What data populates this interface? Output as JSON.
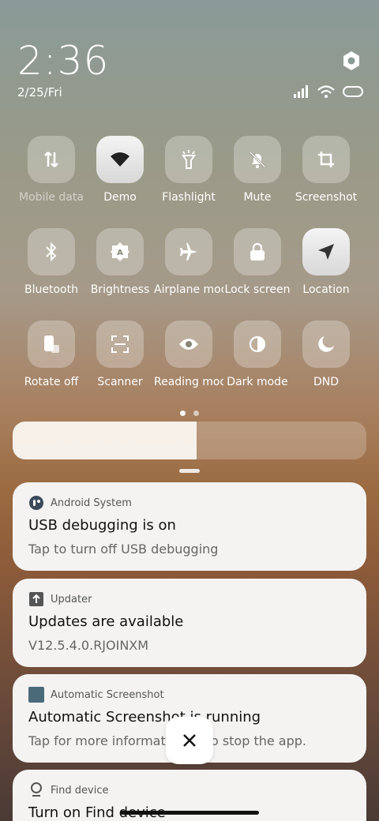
{
  "header": {
    "time": "2:36",
    "date": "2/25/Fri"
  },
  "tiles_row1": [
    {
      "label": "Mobile data",
      "icon": "mobile-data-icon"
    },
    {
      "label": "Demo",
      "icon": "wifi-icon"
    },
    {
      "label": "Flashlight",
      "icon": "flashlight-icon"
    },
    {
      "label": "Mute",
      "icon": "bell-off-icon"
    },
    {
      "label": "Screenshot",
      "icon": "screenshot-icon"
    }
  ],
  "tiles_row2": [
    {
      "label": "Bluetooth",
      "icon": "bluetooth-icon"
    },
    {
      "label": "Brightness",
      "icon": "auto-brightness-icon"
    },
    {
      "label": "Airplane mode",
      "icon": "airplane-icon"
    },
    {
      "label": "Lock screen",
      "icon": "lock-icon"
    },
    {
      "label": "Location",
      "icon": "location-icon"
    }
  ],
  "tiles_row3": [
    {
      "label": "Rotate off",
      "icon": "rotate-icon"
    },
    {
      "label": "Scanner",
      "icon": "scanner-icon"
    },
    {
      "label": "Reading mode",
      "icon": "eye-icon"
    },
    {
      "label": "Dark mode",
      "icon": "dark-mode-icon"
    },
    {
      "label": "DND",
      "icon": "moon-icon"
    }
  ],
  "brightness": {
    "level": 0.52
  },
  "notifications": [
    {
      "app": "Android System",
      "title": "USB debugging is on",
      "body": "Tap to turn off USB debugging"
    },
    {
      "app": "Updater",
      "title": "Updates are available",
      "body": "V12.5.4.0.RJOINXM"
    },
    {
      "app": "Automatic Screenshot",
      "title": "Automatic Screenshot is running",
      "body": "Tap for more information or to stop the app."
    },
    {
      "app": "Find device",
      "title": "Turn on Find device",
      "body": ""
    }
  ],
  "colors": {
    "card_bg": "#f4f3f2",
    "accent": "#111111"
  }
}
